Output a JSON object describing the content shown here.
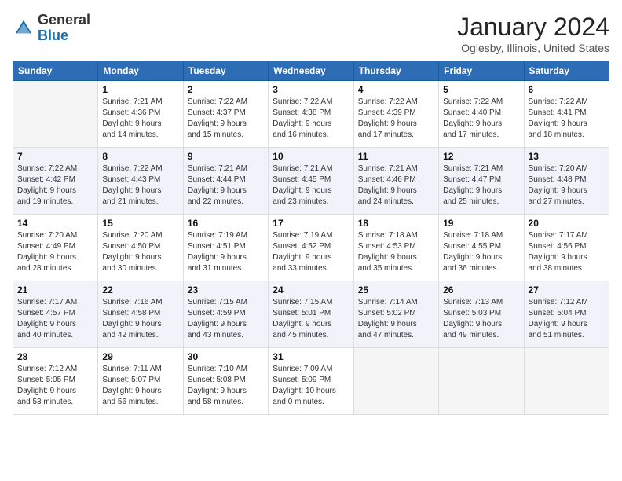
{
  "header": {
    "logo_general": "General",
    "logo_blue": "Blue",
    "month_title": "January 2024",
    "location": "Oglesby, Illinois, United States"
  },
  "days_of_week": [
    "Sunday",
    "Monday",
    "Tuesday",
    "Wednesday",
    "Thursday",
    "Friday",
    "Saturday"
  ],
  "weeks": [
    [
      {
        "day": "",
        "info": ""
      },
      {
        "day": "1",
        "info": "Sunrise: 7:21 AM\nSunset: 4:36 PM\nDaylight: 9 hours\nand 14 minutes."
      },
      {
        "day": "2",
        "info": "Sunrise: 7:22 AM\nSunset: 4:37 PM\nDaylight: 9 hours\nand 15 minutes."
      },
      {
        "day": "3",
        "info": "Sunrise: 7:22 AM\nSunset: 4:38 PM\nDaylight: 9 hours\nand 16 minutes."
      },
      {
        "day": "4",
        "info": "Sunrise: 7:22 AM\nSunset: 4:39 PM\nDaylight: 9 hours\nand 17 minutes."
      },
      {
        "day": "5",
        "info": "Sunrise: 7:22 AM\nSunset: 4:40 PM\nDaylight: 9 hours\nand 17 minutes."
      },
      {
        "day": "6",
        "info": "Sunrise: 7:22 AM\nSunset: 4:41 PM\nDaylight: 9 hours\nand 18 minutes."
      }
    ],
    [
      {
        "day": "7",
        "info": "Sunrise: 7:22 AM\nSunset: 4:42 PM\nDaylight: 9 hours\nand 19 minutes."
      },
      {
        "day": "8",
        "info": "Sunrise: 7:22 AM\nSunset: 4:43 PM\nDaylight: 9 hours\nand 21 minutes."
      },
      {
        "day": "9",
        "info": "Sunrise: 7:21 AM\nSunset: 4:44 PM\nDaylight: 9 hours\nand 22 minutes."
      },
      {
        "day": "10",
        "info": "Sunrise: 7:21 AM\nSunset: 4:45 PM\nDaylight: 9 hours\nand 23 minutes."
      },
      {
        "day": "11",
        "info": "Sunrise: 7:21 AM\nSunset: 4:46 PM\nDaylight: 9 hours\nand 24 minutes."
      },
      {
        "day": "12",
        "info": "Sunrise: 7:21 AM\nSunset: 4:47 PM\nDaylight: 9 hours\nand 25 minutes."
      },
      {
        "day": "13",
        "info": "Sunrise: 7:20 AM\nSunset: 4:48 PM\nDaylight: 9 hours\nand 27 minutes."
      }
    ],
    [
      {
        "day": "14",
        "info": "Sunrise: 7:20 AM\nSunset: 4:49 PM\nDaylight: 9 hours\nand 28 minutes."
      },
      {
        "day": "15",
        "info": "Sunrise: 7:20 AM\nSunset: 4:50 PM\nDaylight: 9 hours\nand 30 minutes."
      },
      {
        "day": "16",
        "info": "Sunrise: 7:19 AM\nSunset: 4:51 PM\nDaylight: 9 hours\nand 31 minutes."
      },
      {
        "day": "17",
        "info": "Sunrise: 7:19 AM\nSunset: 4:52 PM\nDaylight: 9 hours\nand 33 minutes."
      },
      {
        "day": "18",
        "info": "Sunrise: 7:18 AM\nSunset: 4:53 PM\nDaylight: 9 hours\nand 35 minutes."
      },
      {
        "day": "19",
        "info": "Sunrise: 7:18 AM\nSunset: 4:55 PM\nDaylight: 9 hours\nand 36 minutes."
      },
      {
        "day": "20",
        "info": "Sunrise: 7:17 AM\nSunset: 4:56 PM\nDaylight: 9 hours\nand 38 minutes."
      }
    ],
    [
      {
        "day": "21",
        "info": "Sunrise: 7:17 AM\nSunset: 4:57 PM\nDaylight: 9 hours\nand 40 minutes."
      },
      {
        "day": "22",
        "info": "Sunrise: 7:16 AM\nSunset: 4:58 PM\nDaylight: 9 hours\nand 42 minutes."
      },
      {
        "day": "23",
        "info": "Sunrise: 7:15 AM\nSunset: 4:59 PM\nDaylight: 9 hours\nand 43 minutes."
      },
      {
        "day": "24",
        "info": "Sunrise: 7:15 AM\nSunset: 5:01 PM\nDaylight: 9 hours\nand 45 minutes."
      },
      {
        "day": "25",
        "info": "Sunrise: 7:14 AM\nSunset: 5:02 PM\nDaylight: 9 hours\nand 47 minutes."
      },
      {
        "day": "26",
        "info": "Sunrise: 7:13 AM\nSunset: 5:03 PM\nDaylight: 9 hours\nand 49 minutes."
      },
      {
        "day": "27",
        "info": "Sunrise: 7:12 AM\nSunset: 5:04 PM\nDaylight: 9 hours\nand 51 minutes."
      }
    ],
    [
      {
        "day": "28",
        "info": "Sunrise: 7:12 AM\nSunset: 5:05 PM\nDaylight: 9 hours\nand 53 minutes."
      },
      {
        "day": "29",
        "info": "Sunrise: 7:11 AM\nSunset: 5:07 PM\nDaylight: 9 hours\nand 56 minutes."
      },
      {
        "day": "30",
        "info": "Sunrise: 7:10 AM\nSunset: 5:08 PM\nDaylight: 9 hours\nand 58 minutes."
      },
      {
        "day": "31",
        "info": "Sunrise: 7:09 AM\nSunset: 5:09 PM\nDaylight: 10 hours\nand 0 minutes."
      },
      {
        "day": "",
        "info": ""
      },
      {
        "day": "",
        "info": ""
      },
      {
        "day": "",
        "info": ""
      }
    ]
  ]
}
